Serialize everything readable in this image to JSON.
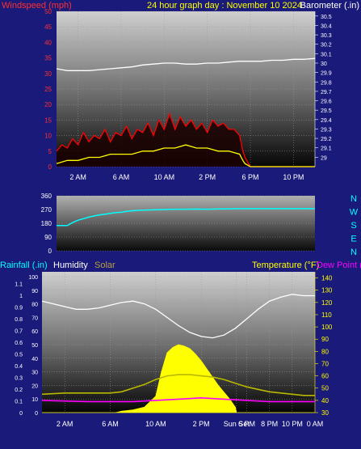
{
  "header": {
    "left": "Windspeed (mph)",
    "center": "24 hour graph day : November 10 2024",
    "right": "Barometer (.in)"
  },
  "colors": {
    "background": "#1a1a7a",
    "wind_gust": "#ff0000",
    "wind_avg": "#ffff00",
    "barometer": "#ffffff",
    "direction": "#00ffff",
    "humidity": "#ffffff",
    "solar": "#ffff00",
    "temperature": "#b8b800",
    "dew_point": "#ff00ff",
    "rainfall": "#00ffff",
    "left_axis": "#ff3030",
    "right_axis": "#ffffff",
    "time_axis": "#ffffff"
  },
  "chart_data": [
    {
      "type": "line",
      "name": "wind-barometer",
      "x_ticks": [
        "2 AM",
        "6 AM",
        "10 AM",
        "2 PM",
        "6 PM",
        "10 PM"
      ],
      "x_tick_hours": [
        2,
        6,
        10,
        14,
        18,
        22
      ],
      "left_axis": {
        "label": "Windspeed (mph)",
        "ticks": [
          0,
          5,
          10,
          15,
          20,
          25,
          30,
          35,
          40,
          45,
          50
        ],
        "ylim": [
          0,
          50
        ]
      },
      "right_axis": {
        "label": "Barometer (.in)",
        "ticks": [
          29,
          29.1,
          29.2,
          29.3,
          29.4,
          29.5,
          29.6,
          29.7,
          29.8,
          29.9,
          30,
          30.1,
          30.2,
          30.3,
          30.4,
          30.5
        ],
        "ylim": [
          28.9,
          30.55
        ]
      },
      "series": [
        {
          "key": "barometer",
          "axis": "right",
          "x": [
            0,
            0.5,
            1,
            1.5,
            2,
            2.5,
            3,
            4,
            5,
            6,
            7,
            8,
            9,
            10,
            11,
            12,
            13,
            14,
            15,
            16,
            17,
            18,
            19,
            20,
            21,
            22,
            23,
            24
          ],
          "y": [
            29.94,
            29.93,
            29.92,
            29.92,
            29.92,
            29.92,
            29.92,
            29.93,
            29.94,
            29.95,
            29.96,
            29.98,
            29.99,
            30.0,
            30.0,
            29.99,
            29.99,
            30.0,
            30.0,
            30.01,
            30.02,
            30.02,
            30.02,
            30.03,
            30.03,
            30.04,
            30.04,
            30.05
          ]
        },
        {
          "key": "wind_gust",
          "axis": "left",
          "x": [
            0,
            0.5,
            1,
            1.5,
            2,
            2.5,
            3,
            3.5,
            4,
            4.5,
            5,
            5.5,
            6,
            6.5,
            7,
            7.5,
            8,
            8.5,
            9,
            9.5,
            10,
            10.5,
            11,
            11.5,
            12,
            12.5,
            13,
            13.5,
            14,
            14.5,
            15,
            15.5,
            16,
            16.5,
            17,
            17.3,
            17.5,
            18,
            19,
            20,
            21,
            22,
            23,
            24
          ],
          "y": [
            5,
            7,
            6,
            9,
            7,
            11,
            8,
            10,
            9,
            12,
            8,
            11,
            10,
            13,
            9,
            12,
            11,
            14,
            10,
            15,
            12,
            17,
            12,
            16,
            13,
            15,
            12,
            14,
            11,
            15,
            13,
            14,
            12,
            12,
            10,
            5,
            3,
            0,
            0,
            0,
            0,
            0,
            0,
            0
          ]
        },
        {
          "key": "wind_avg",
          "axis": "left",
          "x": [
            0,
            1,
            2,
            3,
            4,
            5,
            6,
            7,
            8,
            9,
            10,
            11,
            12,
            13,
            14,
            15,
            16,
            17,
            17.3,
            17.5,
            18,
            24
          ],
          "y": [
            1,
            2,
            2,
            3,
            3,
            4,
            4,
            4,
            5,
            5,
            6,
            6,
            7,
            6,
            6,
            5,
            5,
            4,
            2,
            1,
            0,
            0
          ]
        }
      ]
    },
    {
      "type": "line",
      "name": "wind-direction",
      "left_axis": {
        "ticks": [
          0,
          90,
          180,
          270,
          360
        ],
        "ylim": [
          0,
          360
        ]
      },
      "right_labels": [
        "N",
        "W",
        "S",
        "E",
        "N"
      ],
      "series": [
        {
          "key": "direction",
          "x": [
            0,
            0.5,
            1,
            1.5,
            2,
            2.5,
            3,
            3.5,
            4,
            4.5,
            5,
            5.5,
            6,
            6.5,
            7,
            8,
            9,
            10,
            11,
            12,
            13,
            14,
            15,
            16,
            17,
            18,
            19,
            20,
            21,
            22,
            23,
            24
          ],
          "y": [
            165,
            165,
            165,
            185,
            200,
            210,
            220,
            228,
            235,
            240,
            245,
            250,
            252,
            258,
            262,
            266,
            268,
            270,
            272,
            272,
            273,
            272,
            274,
            275,
            276,
            276,
            276,
            276,
            276,
            276,
            276,
            276
          ]
        }
      ]
    },
    {
      "type": "line",
      "name": "humidity-temperature",
      "x_ticks": [
        "2 AM",
        "6 AM",
        "10 AM",
        "2 PM",
        "Sun Set",
        "6 PM",
        "8 PM",
        "10 PM",
        "0 AM"
      ],
      "x_tick_hours": [
        2,
        6,
        10,
        14,
        17.1,
        18,
        20,
        22,
        24
      ],
      "legend": [
        "Rainfall (.in)",
        "Humidity",
        "Solar",
        "Temperature (°F)",
        "Dew Point (°F)"
      ],
      "rain_axis": {
        "label": "Rainfall (.in)",
        "ticks": [
          0,
          0.1,
          0.2,
          0.3,
          0.4,
          0.5,
          0.6,
          0.7,
          0.8,
          0.9,
          1,
          1.1
        ],
        "ylim": [
          0,
          1.2
        ]
      },
      "humidity_axis": {
        "label": "Humidity",
        "ticks": [
          0,
          10,
          20,
          30,
          40,
          50,
          60,
          70,
          80,
          90,
          100
        ],
        "ylim": [
          0,
          100
        ]
      },
      "temp_axis": {
        "label": "Temperature (°F)",
        "ticks": [
          30,
          40,
          50,
          60,
          70,
          80,
          90,
          100,
          110,
          120,
          130,
          140
        ],
        "ylim": [
          30,
          145
        ]
      },
      "series": [
        {
          "key": "humidity",
          "axis": "humidity",
          "x": [
            0,
            1,
            2,
            3,
            4,
            5,
            6,
            7,
            8,
            9,
            10,
            11,
            12,
            13,
            14,
            15,
            16,
            17,
            18,
            19,
            20,
            21,
            22,
            23,
            24
          ],
          "y": [
            82,
            80,
            78,
            76,
            76,
            77,
            79,
            81,
            82,
            80,
            76,
            70,
            64,
            59,
            56,
            55,
            57,
            62,
            69,
            76,
            82,
            85,
            87,
            86,
            86
          ]
        },
        {
          "key": "solar",
          "axis": "humidity",
          "x": [
            0,
            6.5,
            7,
            8,
            9,
            10,
            10.5,
            11,
            11.5,
            12,
            12.5,
            13,
            13.5,
            14,
            14.5,
            15,
            15.5,
            16,
            16.5,
            17,
            17.1,
            24
          ],
          "y": [
            0,
            0,
            1,
            2,
            4,
            12,
            30,
            44,
            48,
            50,
            49,
            47,
            43,
            38,
            32,
            26,
            20,
            15,
            10,
            4,
            0,
            0
          ]
        },
        {
          "key": "temperature",
          "axis": "temp",
          "x": [
            0,
            2,
            4,
            6,
            7,
            8,
            9,
            10,
            11,
            12,
            13,
            14,
            15,
            16,
            17,
            18,
            19,
            20,
            21,
            22,
            23,
            24
          ],
          "y": [
            45,
            46,
            46,
            46,
            47,
            50,
            53,
            57,
            60,
            61,
            61,
            60,
            59,
            57,
            54,
            51,
            49,
            47,
            46,
            45,
            44,
            44
          ]
        },
        {
          "key": "dew_point",
          "axis": "temp",
          "x": [
            0,
            4,
            8,
            10,
            12,
            14,
            16,
            18,
            20,
            22,
            24
          ],
          "y": [
            40,
            39,
            39,
            40,
            41,
            42,
            41,
            40,
            39,
            39,
            39
          ]
        }
      ]
    }
  ]
}
